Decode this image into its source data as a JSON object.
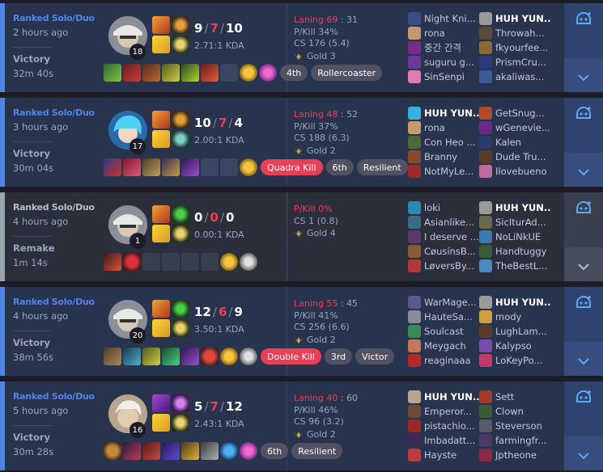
{
  "colors": {
    "accent": "#5383e8",
    "loss_red": "#e84057",
    "remake_gray": "#9aa4af"
  },
  "games": [
    {
      "queue": "Ranked Solo/Duo",
      "time_ago": "2 hours ago",
      "result": "Victory",
      "duration": "32m 40s",
      "champion": "champion-portrait",
      "level": "18",
      "kills": "9",
      "deaths": "7",
      "assists": "10",
      "ratio": "2.71:1 KDA",
      "laning_label": "Laning 69",
      "laning_rest": "31",
      "pkill": "P/Kill 34%",
      "cs": "CS 176 (5.4)",
      "gold": "Gold 3",
      "badges": [
        "4th",
        "Rollercoaster"
      ],
      "team1": [
        "Night Kni...",
        "rona",
        "중간 간격",
        "suguru g...",
        "SinSenpi"
      ],
      "team2": [
        "HUH YUN...",
        "Throwah...",
        "fkyourfee...",
        "PrismCru...",
        "akaliwas..."
      ],
      "me": "team2-0"
    },
    {
      "queue": "Ranked Solo/Duo",
      "time_ago": "3 hours ago",
      "result": "Victory",
      "duration": "30m 04s",
      "level": "17",
      "kills": "10",
      "deaths": "7",
      "assists": "4",
      "ratio": "2.00:1 KDA",
      "laning_label": "Laning 48",
      "laning_rest": "52",
      "pkill": "P/Kill 37%",
      "cs": "CS 188 (6.3)",
      "gold": "Gold 2",
      "badges": [
        "Quadra Kill",
        "6th",
        "Resilient"
      ],
      "team1": [
        "HUH YUN...",
        "rona",
        "Con Heo ...",
        "Branny",
        "NotMyLe..."
      ],
      "team2": [
        "GetSnug...",
        "wGenevie...",
        "Kalen",
        "Dude Tru...",
        "Ilovebueno"
      ],
      "me": "team1-0"
    },
    {
      "queue": "Ranked Solo/Duo",
      "time_ago": "4 hours ago",
      "result": "Remake",
      "duration": "1m 14s",
      "level": "1",
      "kills": "0",
      "deaths": "0",
      "assists": "0",
      "ratio": "0.00:1 KDA",
      "pkill_remake": "P/Kill 0%",
      "cs": "CS 1 (0.8)",
      "gold": "Gold 4",
      "team1": [
        "loki",
        "Asianlike...",
        "I deserve ...",
        "CøusínsB...",
        "LøversBy..."
      ],
      "team2": [
        "HUH YUN...",
        "SicIturAd...",
        "NoLiNkUE",
        "Handtuggy",
        "TheBestL..."
      ],
      "me": "team2-0"
    },
    {
      "queue": "Ranked Solo/Duo",
      "time_ago": "4 hours ago",
      "result": "Victory",
      "duration": "38m 56s",
      "level": "20",
      "kills": "12",
      "deaths": "6",
      "assists": "9",
      "ratio": "3.50:1 KDA",
      "laning_label": "Laning 55",
      "laning_rest": "45",
      "pkill": "P/Kill 41%",
      "cs": "CS 256 (6.6)",
      "gold": "Gold 2",
      "badges": [
        "Double Kill",
        "3rd",
        "Victor"
      ],
      "team1": [
        "WarMage...",
        "HauteSa...",
        "Soulcast",
        "Meygach",
        "reaginaaa"
      ],
      "team2": [
        "HUH YUN...",
        "mody",
        "LughLam...",
        "Kalypso",
        "LoKeyPo..."
      ],
      "me": "team2-0"
    },
    {
      "queue": "Ranked Solo/Duo",
      "time_ago": "5 hours ago",
      "result": "Victory",
      "duration": "30m 28s",
      "level": "16",
      "kills": "5",
      "deaths": "7",
      "assists": "12",
      "ratio": "2.43:1 KDA",
      "laning_label": "Laning 40",
      "laning_rest": "60",
      "pkill": "P/Kill 46%",
      "cs": "CS 96 (3.2)",
      "gold": "Gold 2",
      "badges": [
        "6th",
        "Resilient"
      ],
      "team1": [
        "HUH YUN...",
        "Emperor...",
        "pistachio...",
        "Imbadatt...",
        "Hayste"
      ],
      "team2": [
        "Sett",
        "Clown",
        "Steverson",
        "farmingfr...",
        "Jptheone"
      ],
      "me": "team1-0"
    }
  ]
}
